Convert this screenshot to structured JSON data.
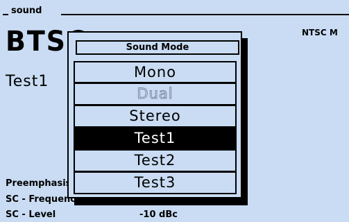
{
  "header": {
    "section_label": "sound"
  },
  "standard": {
    "code": "BTSC",
    "video_standard_partial": "NTSC M"
  },
  "current_mode": "Test1",
  "parameters": [
    {
      "label": "Preemphasis",
      "value": ""
    },
    {
      "label": "SC - Frequency",
      "value": ""
    },
    {
      "label": "SC - Level",
      "value": "-10 dBc"
    }
  ],
  "popup": {
    "title": "Sound Mode",
    "options": [
      {
        "label": "Mono",
        "state": "normal"
      },
      {
        "label": "Dual",
        "state": "disabled"
      },
      {
        "label": "Stereo",
        "state": "normal"
      },
      {
        "label": "Test1",
        "state": "selected"
      },
      {
        "label": "Test2",
        "state": "normal"
      },
      {
        "label": "Test3",
        "state": "normal"
      }
    ]
  },
  "colors": {
    "background": "#c9dcf3",
    "foreground": "#000000",
    "selection_text": "#ffffff",
    "disabled_text": "#7a8aa0"
  }
}
